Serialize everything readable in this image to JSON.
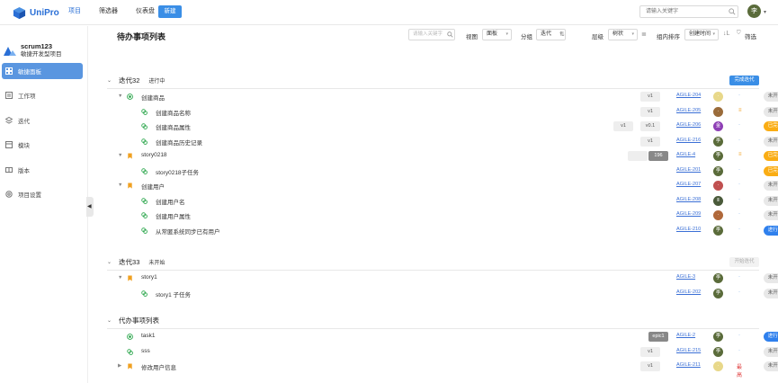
{
  "app": {
    "name": "UniPro"
  },
  "nav": {
    "items": [
      "项目",
      "筛选器",
      "仪表盘"
    ],
    "new_label": "新建",
    "search_placeholder": "请输入关键字",
    "user_initial": "李"
  },
  "sidebar": {
    "project_name": "scrum123",
    "project_type": "敏捷开发型项目",
    "items": [
      {
        "label": "敏捷面板",
        "icon": "board-icon"
      },
      {
        "label": "工作项",
        "icon": "workitem-icon"
      },
      {
        "label": "迭代",
        "icon": "iteration-icon"
      },
      {
        "label": "模块",
        "icon": "module-icon"
      },
      {
        "label": "版本",
        "icon": "version-icon"
      },
      {
        "label": "项目设置",
        "icon": "settings-icon"
      }
    ]
  },
  "main": {
    "title": "待办事项列表",
    "search_placeholder": "请输入关键字",
    "view_label": "视图",
    "view_value": "面板",
    "group_label": "分组",
    "group_value": "迭代",
    "level_label": "层级",
    "level_value": "树状",
    "sort_label": "组内排序",
    "sort_value": "创建时间",
    "filter_label": "筛选"
  },
  "sections": [
    {
      "name": "迭代32",
      "status": "进行中",
      "action": "完成迭代",
      "rows": [
        {
          "title": "创建商品",
          "type": "task",
          "caret": "▼",
          "version": "v1",
          "key": "AGILE-204",
          "avatar": "·",
          "avatar_color": "#e8d88a",
          "priority": "·",
          "status": "未开始",
          "st": "todo",
          "indent": 0
        },
        {
          "title": "创建商品名称",
          "type": "subtask",
          "version": "v1",
          "key": "AGILE-205",
          "avatar": "·",
          "avatar_color": "#9a6b3a",
          "priority": "≡",
          "status": "未开始",
          "st": "todo",
          "indent": 1
        },
        {
          "title": "创建商品属性",
          "type": "subtask",
          "version": "v0.1",
          "version2": "v1",
          "key": "AGILE-206",
          "avatar": "金",
          "avatar_color": "#8e3fb5",
          "priority": "·",
          "status": "已完成",
          "st": "done",
          "indent": 1
        },
        {
          "title": "创建商品历史记录",
          "type": "subtask",
          "version": "v1",
          "key": "AGILE-216",
          "avatar": "李",
          "avatar_color": "#5a6b3a",
          "priority": "·",
          "status": "未开始",
          "st": "todo",
          "indent": 1
        },
        {
          "title": "story0218",
          "type": "story",
          "caret": "▼",
          "version": "",
          "version_dark": "196",
          "key": "AGILE-4",
          "avatar": "李",
          "avatar_color": "#5a6b3a",
          "priority": "≡",
          "status": "已完成",
          "st": "done",
          "count": "1",
          "indent": 0
        },
        {
          "title": "story0218子任务",
          "type": "subtask",
          "version": "",
          "key": "AGILE-201",
          "avatar": "李",
          "avatar_color": "#5a6b3a",
          "priority": "·",
          "status": "已完成",
          "st": "done",
          "indent": 1
        },
        {
          "title": "创建用户",
          "type": "story",
          "caret": "▼",
          "version": "",
          "key": "AGILE-207",
          "avatar": "·",
          "avatar_color": "#c05050",
          "priority": "·",
          "status": "未开始",
          "st": "todo",
          "indent": 0
        },
        {
          "title": "创建用户名",
          "type": "subtask",
          "version": "",
          "key": "AGILE-208",
          "avatar": "Ⅱ",
          "avatar_color": "#4a5a3a",
          "priority": "·",
          "status": "未开始",
          "st": "todo",
          "indent": 1
        },
        {
          "title": "创建用户属性",
          "type": "subtask",
          "version": "",
          "key": "AGILE-209",
          "avatar": "·",
          "avatar_color": "#b0683a",
          "priority": "·",
          "status": "未开始",
          "st": "todo",
          "indent": 1
        },
        {
          "title": "从常匿系统同步已有用户",
          "type": "subtask",
          "version": "",
          "key": "AGILE-210",
          "avatar": "李",
          "avatar_color": "#5a6b3a",
          "priority": "·",
          "status": "进行中",
          "st": "prog",
          "indent": 1
        }
      ]
    },
    {
      "name": "迭代33",
      "status": "未开始",
      "action": "开始迭代",
      "rows": [
        {
          "title": "story1",
          "type": "story",
          "caret": "▼",
          "version": "",
          "key": "AGILE-3",
          "avatar": "李",
          "avatar_color": "#5a6b3a",
          "priority": "·",
          "status": "未开始",
          "st": "todo",
          "count": "2",
          "indent": 0
        },
        {
          "title": "story1 子任务",
          "type": "subtask",
          "version": "",
          "key": "AGILE-202",
          "avatar": "李",
          "avatar_color": "#5a6b3a",
          "priority": "·",
          "status": "未开始",
          "st": "todo",
          "indent": 1
        }
      ]
    },
    {
      "name": "代办事项列表",
      "status": "",
      "action": "",
      "rows": [
        {
          "title": "task1",
          "type": "task",
          "version": "",
          "version_dark": "epic1",
          "key": "AGILE-2",
          "avatar": "李",
          "avatar_color": "#5a6b3a",
          "priority": "·",
          "status": "进行中",
          "st": "prog",
          "indent": 0
        },
        {
          "title": "sss",
          "type": "subtask",
          "version": "v1",
          "key": "AGILE-215",
          "avatar": "李",
          "avatar_color": "#5a6b3a",
          "priority": "·",
          "status": "未开始",
          "st": "todo",
          "indent": 0
        },
        {
          "title": "修改用户信息",
          "type": "story",
          "caret": "▶",
          "version": "v1",
          "key": "AGILE-211",
          "avatar": "·",
          "avatar_color": "#e8d88a",
          "priority": "最高",
          "status": "未开始",
          "st": "todo",
          "indent": 0
        }
      ]
    }
  ],
  "colors": {
    "accent": "#2a6fd6",
    "primary_btn": "#3a8ee6",
    "done": "#faad14",
    "in_progress": "#2f80ed",
    "link": "#3a6fd6"
  }
}
